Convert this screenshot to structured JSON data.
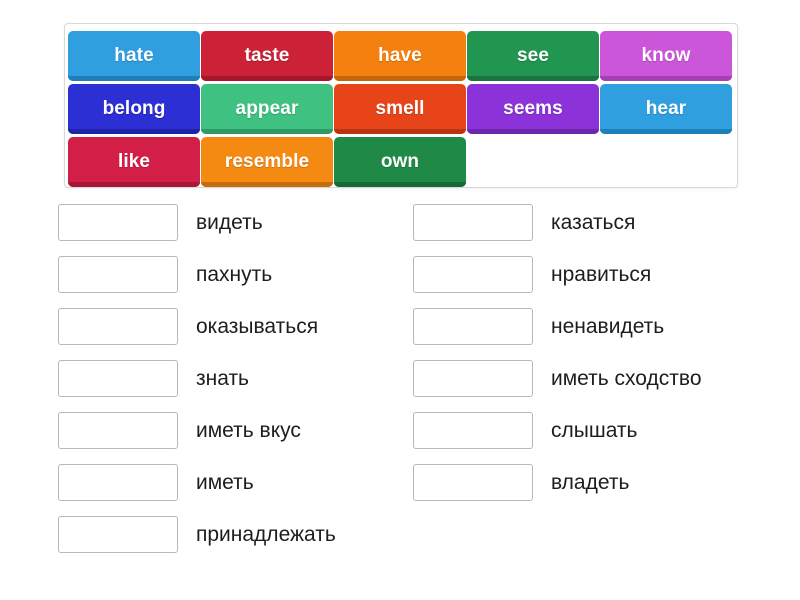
{
  "tray": {
    "rows": [
      [
        {
          "label": "hate",
          "color": "#2f9fe0",
          "shade": "#1c7fba"
        },
        {
          "label": "taste",
          "color": "#cc2136",
          "shade": "#a3192a"
        },
        {
          "label": "have",
          "color": "#f4800f",
          "shade": "#c4650a"
        },
        {
          "label": "see",
          "color": "#219651",
          "shade": "#19733e"
        },
        {
          "label": "know",
          "color": "#cb56da",
          "shade": "#a53fb3"
        }
      ],
      [
        {
          "label": "belong",
          "color": "#2b2fd4",
          "shade": "#2023a8"
        },
        {
          "label": "appear",
          "color": "#3fc182",
          "shade": "#2f9a66"
        },
        {
          "label": "smell",
          "color": "#e8441a",
          "shade": "#ba3412"
        },
        {
          "label": "seems",
          "color": "#8b33d9",
          "shade": "#6d27ab"
        },
        {
          "label": "hear",
          "color": "#2f9fe0",
          "shade": "#1c7fba"
        }
      ],
      [
        {
          "label": "like",
          "color": "#d31f47",
          "shade": "#a91736"
        },
        {
          "label": "resemble",
          "color": "#f58a12",
          "shade": "#c66c0c"
        },
        {
          "label": "own",
          "color": "#1f8a48",
          "shade": "#166a36"
        }
      ]
    ]
  },
  "answers": {
    "left": [
      {
        "term": "видеть"
      },
      {
        "term": "пахнуть"
      },
      {
        "term": "оказываться"
      },
      {
        "term": "знать"
      },
      {
        "term": "иметь вкус"
      },
      {
        "term": "иметь"
      },
      {
        "term": "принадлежать"
      }
    ],
    "right": [
      {
        "term": "казаться"
      },
      {
        "term": "нравиться"
      },
      {
        "term": "ненавидеть"
      },
      {
        "term": "иметь сходство"
      },
      {
        "term": "слышать"
      },
      {
        "term": "владеть"
      }
    ]
  }
}
